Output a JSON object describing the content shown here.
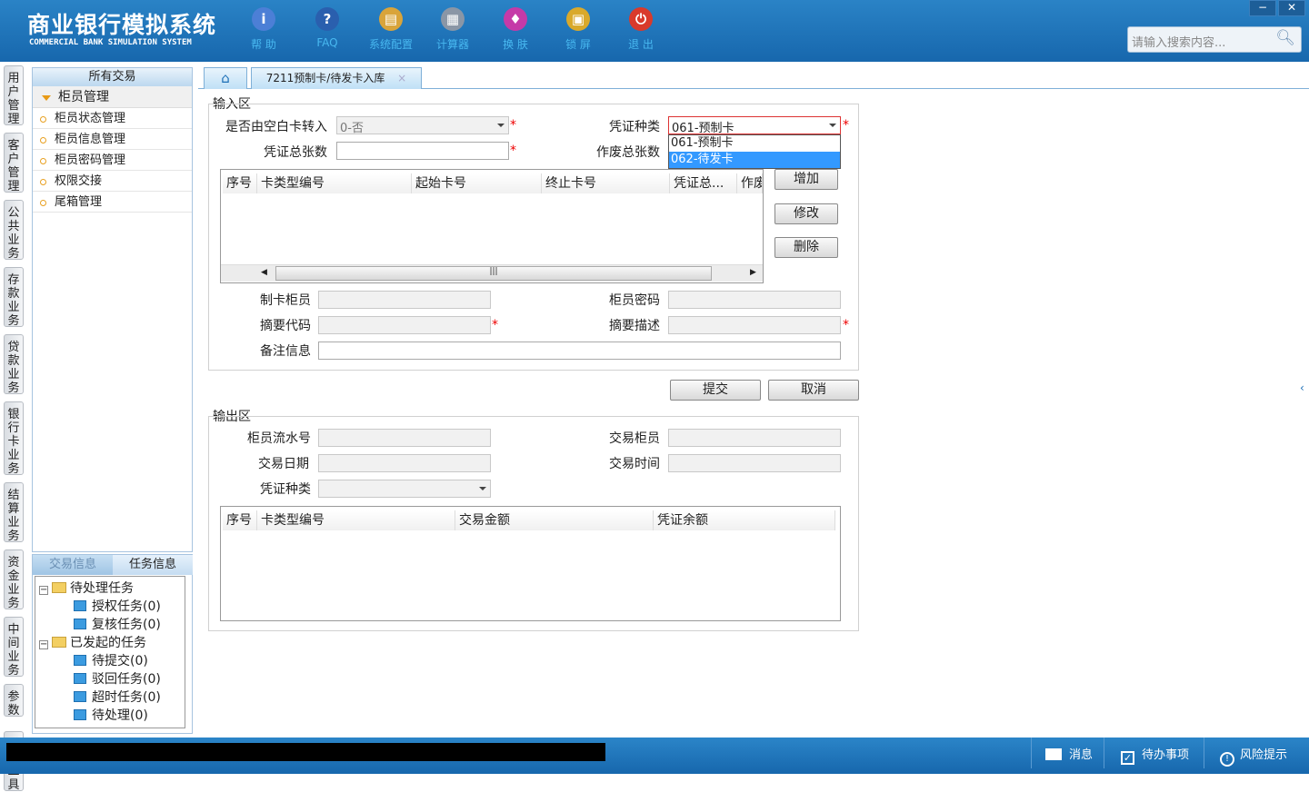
{
  "header": {
    "title": "商业银行模拟系统",
    "subtitle": "COMMERCIAL BANK SIMULATION SYSTEM",
    "toolbar": [
      {
        "label": "帮 助",
        "icon": "info-icon",
        "color": "#4c7fd6"
      },
      {
        "label": "FAQ",
        "icon": "question-icon",
        "color": "#2a5fae"
      },
      {
        "label": "系统配置",
        "icon": "toolbox-icon",
        "color": "#d9a43a"
      },
      {
        "label": "计算器",
        "icon": "calculator-icon",
        "color": "#8a96a6"
      },
      {
        "label": "换 肤",
        "icon": "shirt-icon",
        "color": "#c53aa8"
      },
      {
        "label": "锁 屏",
        "icon": "lock-icon",
        "color": "#d9a92b"
      },
      {
        "label": "退 出",
        "icon": "power-icon",
        "color": "#d93a2b"
      }
    ],
    "search_placeholder": "请输入搜索内容...",
    "minimize": "−",
    "close": "✕"
  },
  "vertical_tabs": [
    "用户管理",
    "客户管理",
    "公共业务",
    "存款业务",
    "贷款业务",
    "银行卡业务",
    "结算业务",
    "资金业务",
    "中间业务",
    "参数",
    "常用工具"
  ],
  "sidebar": {
    "header": "所有交易",
    "group": "柜员管理",
    "items": [
      "柜员状态管理",
      "柜员信息管理",
      "柜员密码管理",
      "权限交接",
      "尾箱管理"
    ]
  },
  "task_panel": {
    "tabs": [
      "交易信息",
      "任务信息"
    ],
    "tree": [
      {
        "label": "待处理任务",
        "children": [
          "授权任务(0)",
          "复核任务(0)"
        ]
      },
      {
        "label": "已发起的任务",
        "children": [
          "待提交(0)",
          "驳回任务(0)",
          "超时任务(0)",
          "待处理(0)"
        ]
      }
    ]
  },
  "tabs": {
    "active": "7211预制卡/待发卡入库",
    "close": "×"
  },
  "input_area": {
    "legend": "输入区",
    "blank_card_label": "是否由空白卡转入",
    "blank_card_value": "0-否",
    "voucher_type_label": "凭证种类",
    "voucher_type_value": "061-预制卡",
    "voucher_options": [
      "061-预制卡",
      "062-待发卡"
    ],
    "total_label": "凭证总张数",
    "void_label": "作废总张数",
    "grid_headers": [
      "序号",
      "卡类型编号",
      "起始卡号",
      "终止卡号",
      "凭证总...",
      "作废"
    ],
    "buttons": [
      "增加",
      "修改",
      "删除"
    ],
    "card_teller_label": "制卡柜员",
    "teller_pwd_label": "柜员密码",
    "summary_code_label": "摘要代码",
    "summary_desc_label": "摘要描述",
    "remark_label": "备注信息"
  },
  "actions": {
    "submit": "提交",
    "cancel": "取消"
  },
  "output_area": {
    "legend": "输出区",
    "serial_label": "柜员流水号",
    "teller_label": "交易柜员",
    "date_label": "交易日期",
    "time_label": "交易时间",
    "voucher_type_label": "凭证种类",
    "grid_headers": [
      "序号",
      "卡类型编号",
      "交易金额",
      "凭证余额"
    ]
  },
  "status_bar": {
    "message": "消息",
    "todo": "待办事项",
    "risk": "风险提示"
  }
}
